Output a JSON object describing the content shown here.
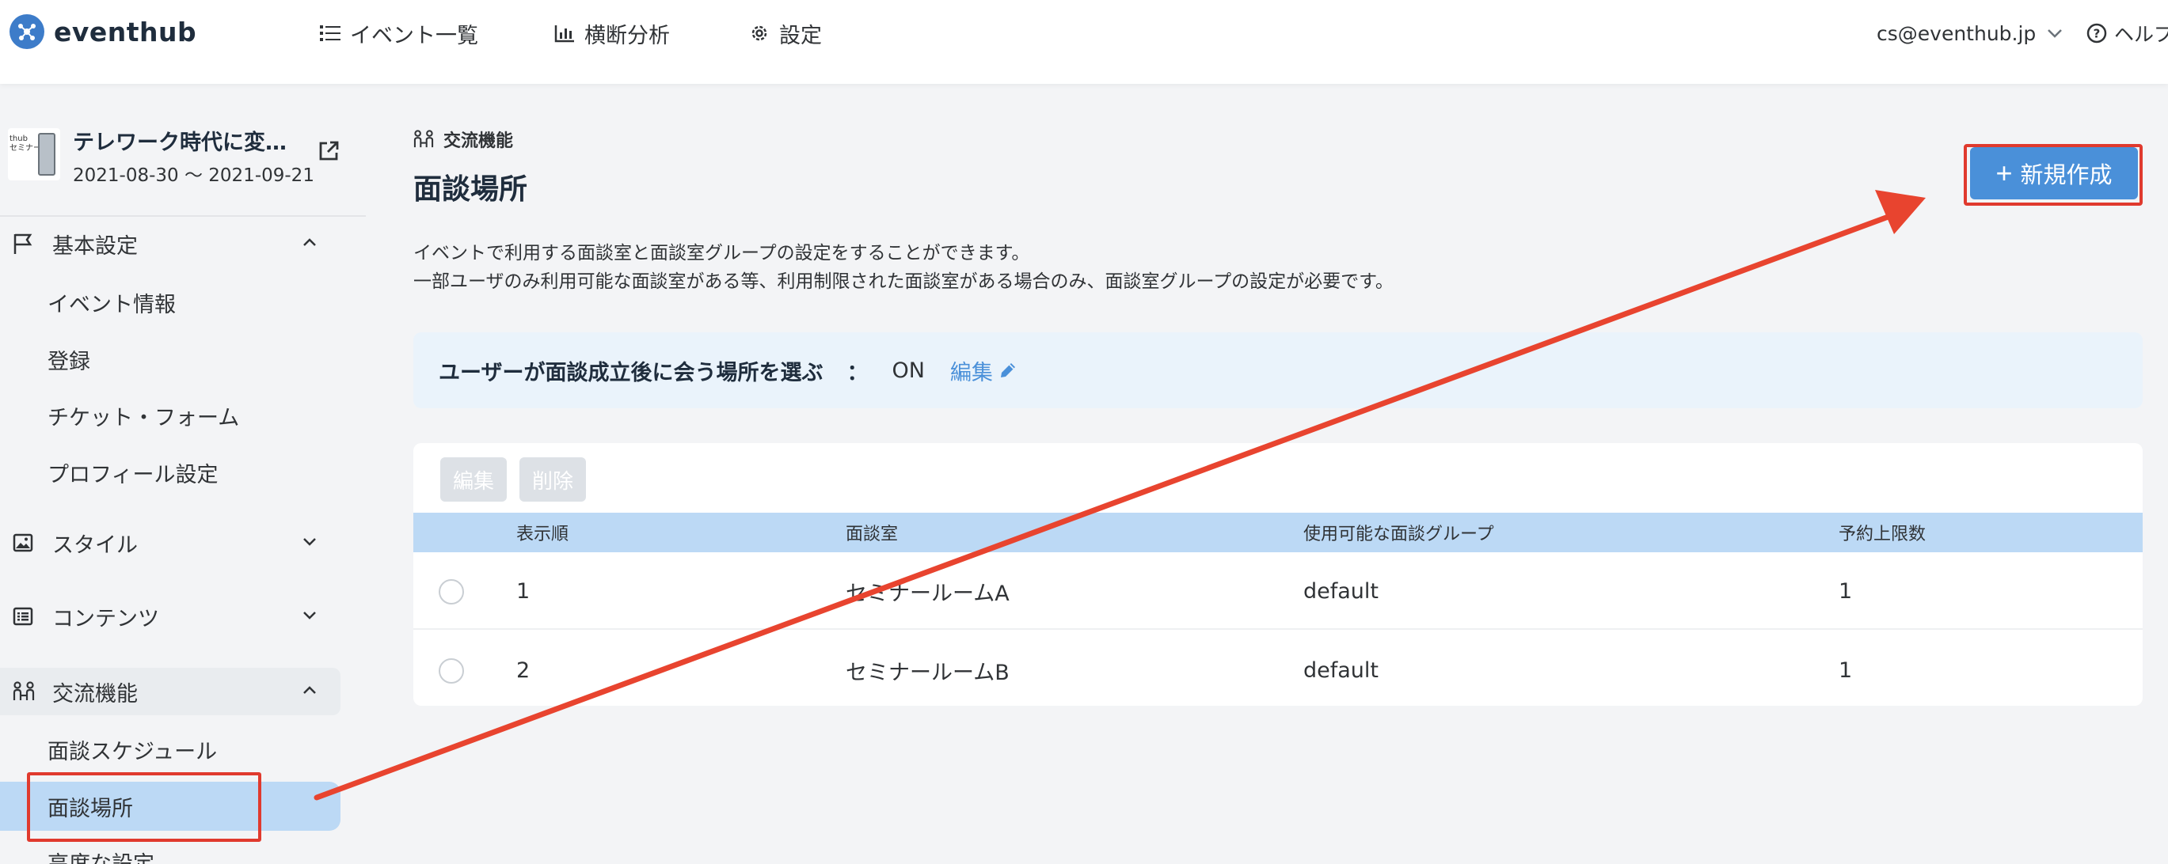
{
  "header": {
    "logo_text": "eventhub",
    "nav": {
      "events": "イベント一覧",
      "analysis": "横断分析",
      "settings": "設定"
    },
    "user_email": "cs@eventhub.jp",
    "help": "ヘルプ"
  },
  "sidebar": {
    "event": {
      "title": "テレワーク時代に変…",
      "dates": "2021-08-30 〜 2021-09-21",
      "thumb_text": "thub\nセミナー"
    },
    "sections": {
      "basic": {
        "label": "基本設定",
        "items": [
          "イベント情報",
          "登録",
          "チケット・フォーム",
          "プロフィール設定"
        ]
      },
      "style": {
        "label": "スタイル"
      },
      "contents": {
        "label": "コンテンツ"
      },
      "networking": {
        "label": "交流機能",
        "items": [
          "面談スケジュール",
          "面談場所",
          "高度な設定"
        ]
      }
    }
  },
  "main": {
    "breadcrumb": "交流機能",
    "title": "面談場所",
    "description": [
      "イベントで利用する面談室と面談室グループの設定をすることができます。",
      "一部ユーザのみ利用可能な面談室がある等、利用制限された面談室がある場合のみ、面談室グループの設定が必要です。"
    ],
    "new_button": "新規作成",
    "setting": {
      "label": "ユーザーが面談成立後に会う場所を選ぶ",
      "colon": "：",
      "value": "ON",
      "edit": "編集"
    },
    "table": {
      "toolbar": {
        "edit": "編集",
        "delete": "削除"
      },
      "columns": [
        "表示順",
        "面談室",
        "使用可能な面談グループ",
        "予約上限数"
      ],
      "rows": [
        {
          "order": "1",
          "room": "セミナールームA",
          "group": "default",
          "limit": "1"
        },
        {
          "order": "2",
          "room": "セミナールームB",
          "group": "default",
          "limit": "1"
        }
      ]
    }
  },
  "colors": {
    "accent": "#4a90d9",
    "selected_bg": "#bcd9f5",
    "annotation": "#e03a2e"
  }
}
